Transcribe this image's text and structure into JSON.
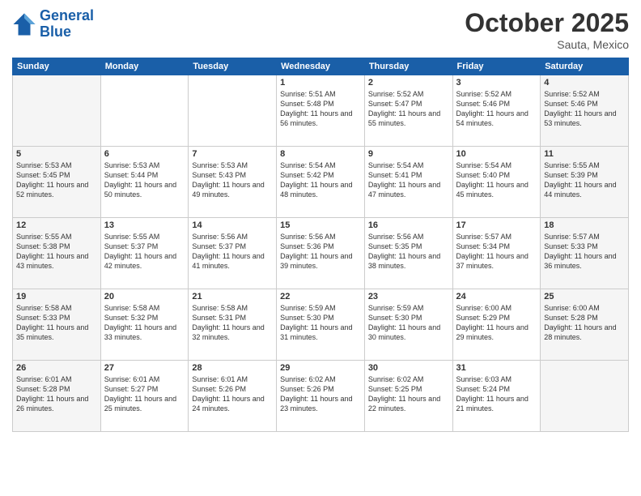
{
  "header": {
    "logo_line1": "General",
    "logo_line2": "Blue",
    "month": "October 2025",
    "location": "Sauta, Mexico"
  },
  "days_of_week": [
    "Sunday",
    "Monday",
    "Tuesday",
    "Wednesday",
    "Thursday",
    "Friday",
    "Saturday"
  ],
  "weeks": [
    [
      {
        "day": "",
        "text": ""
      },
      {
        "day": "",
        "text": ""
      },
      {
        "day": "",
        "text": ""
      },
      {
        "day": "1",
        "text": "Sunrise: 5:51 AM\nSunset: 5:48 PM\nDaylight: 11 hours and 56 minutes."
      },
      {
        "day": "2",
        "text": "Sunrise: 5:52 AM\nSunset: 5:47 PM\nDaylight: 11 hours and 55 minutes."
      },
      {
        "day": "3",
        "text": "Sunrise: 5:52 AM\nSunset: 5:46 PM\nDaylight: 11 hours and 54 minutes."
      },
      {
        "day": "4",
        "text": "Sunrise: 5:52 AM\nSunset: 5:46 PM\nDaylight: 11 hours and 53 minutes."
      }
    ],
    [
      {
        "day": "5",
        "text": "Sunrise: 5:53 AM\nSunset: 5:45 PM\nDaylight: 11 hours and 52 minutes."
      },
      {
        "day": "6",
        "text": "Sunrise: 5:53 AM\nSunset: 5:44 PM\nDaylight: 11 hours and 50 minutes."
      },
      {
        "day": "7",
        "text": "Sunrise: 5:53 AM\nSunset: 5:43 PM\nDaylight: 11 hours and 49 minutes."
      },
      {
        "day": "8",
        "text": "Sunrise: 5:54 AM\nSunset: 5:42 PM\nDaylight: 11 hours and 48 minutes."
      },
      {
        "day": "9",
        "text": "Sunrise: 5:54 AM\nSunset: 5:41 PM\nDaylight: 11 hours and 47 minutes."
      },
      {
        "day": "10",
        "text": "Sunrise: 5:54 AM\nSunset: 5:40 PM\nDaylight: 11 hours and 45 minutes."
      },
      {
        "day": "11",
        "text": "Sunrise: 5:55 AM\nSunset: 5:39 PM\nDaylight: 11 hours and 44 minutes."
      }
    ],
    [
      {
        "day": "12",
        "text": "Sunrise: 5:55 AM\nSunset: 5:38 PM\nDaylight: 11 hours and 43 minutes."
      },
      {
        "day": "13",
        "text": "Sunrise: 5:55 AM\nSunset: 5:37 PM\nDaylight: 11 hours and 42 minutes."
      },
      {
        "day": "14",
        "text": "Sunrise: 5:56 AM\nSunset: 5:37 PM\nDaylight: 11 hours and 41 minutes."
      },
      {
        "day": "15",
        "text": "Sunrise: 5:56 AM\nSunset: 5:36 PM\nDaylight: 11 hours and 39 minutes."
      },
      {
        "day": "16",
        "text": "Sunrise: 5:56 AM\nSunset: 5:35 PM\nDaylight: 11 hours and 38 minutes."
      },
      {
        "day": "17",
        "text": "Sunrise: 5:57 AM\nSunset: 5:34 PM\nDaylight: 11 hours and 37 minutes."
      },
      {
        "day": "18",
        "text": "Sunrise: 5:57 AM\nSunset: 5:33 PM\nDaylight: 11 hours and 36 minutes."
      }
    ],
    [
      {
        "day": "19",
        "text": "Sunrise: 5:58 AM\nSunset: 5:33 PM\nDaylight: 11 hours and 35 minutes."
      },
      {
        "day": "20",
        "text": "Sunrise: 5:58 AM\nSunset: 5:32 PM\nDaylight: 11 hours and 33 minutes."
      },
      {
        "day": "21",
        "text": "Sunrise: 5:58 AM\nSunset: 5:31 PM\nDaylight: 11 hours and 32 minutes."
      },
      {
        "day": "22",
        "text": "Sunrise: 5:59 AM\nSunset: 5:30 PM\nDaylight: 11 hours and 31 minutes."
      },
      {
        "day": "23",
        "text": "Sunrise: 5:59 AM\nSunset: 5:30 PM\nDaylight: 11 hours and 30 minutes."
      },
      {
        "day": "24",
        "text": "Sunrise: 6:00 AM\nSunset: 5:29 PM\nDaylight: 11 hours and 29 minutes."
      },
      {
        "day": "25",
        "text": "Sunrise: 6:00 AM\nSunset: 5:28 PM\nDaylight: 11 hours and 28 minutes."
      }
    ],
    [
      {
        "day": "26",
        "text": "Sunrise: 6:01 AM\nSunset: 5:28 PM\nDaylight: 11 hours and 26 minutes."
      },
      {
        "day": "27",
        "text": "Sunrise: 6:01 AM\nSunset: 5:27 PM\nDaylight: 11 hours and 25 minutes."
      },
      {
        "day": "28",
        "text": "Sunrise: 6:01 AM\nSunset: 5:26 PM\nDaylight: 11 hours and 24 minutes."
      },
      {
        "day": "29",
        "text": "Sunrise: 6:02 AM\nSunset: 5:26 PM\nDaylight: 11 hours and 23 minutes."
      },
      {
        "day": "30",
        "text": "Sunrise: 6:02 AM\nSunset: 5:25 PM\nDaylight: 11 hours and 22 minutes."
      },
      {
        "day": "31",
        "text": "Sunrise: 6:03 AM\nSunset: 5:24 PM\nDaylight: 11 hours and 21 minutes."
      },
      {
        "day": "",
        "text": ""
      }
    ]
  ]
}
